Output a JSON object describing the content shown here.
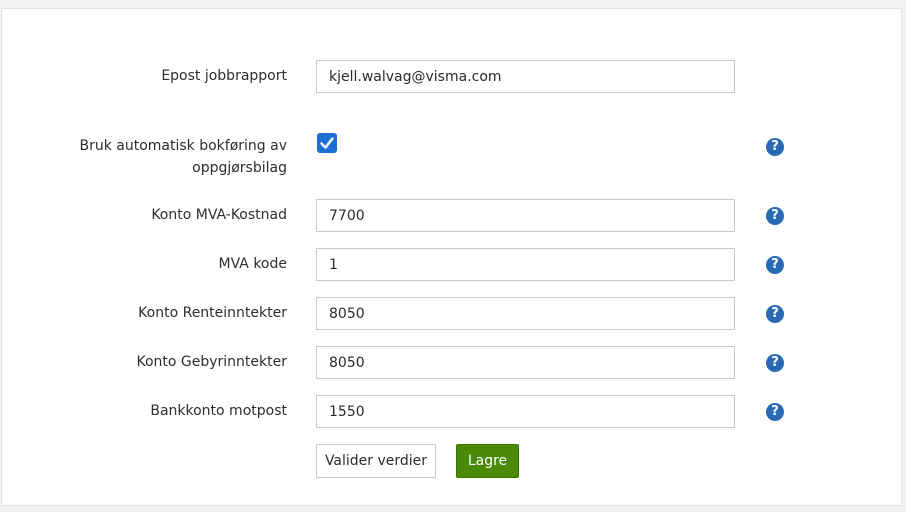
{
  "form": {
    "email_label": "Epost jobbrapport",
    "email_value": "kjell.walvag@visma.com",
    "auto_booking_label_line1": "Bruk automatisk bokføring av",
    "auto_booking_label_line2": "oppgjørsbilag",
    "auto_booking_checked": true,
    "mva_cost_label": "Konto MVA-Kostnad",
    "mva_cost_value": "7700",
    "mva_code_label": "MVA kode",
    "mva_code_value": "1",
    "interest_income_label": "Konto Renteinntekter",
    "interest_income_value": "8050",
    "fee_income_label": "Konto Gebyrinntekter",
    "fee_income_value": "8050",
    "bank_account_label": "Bankkonto motpost",
    "bank_account_value": "1550",
    "help_glyph": "?"
  },
  "actions": {
    "validate_label": "Valider verdier",
    "save_label": "Lagre"
  },
  "colors": {
    "accent_blue": "#1c6fd3",
    "help_blue": "#2a6ab4",
    "save_green": "#4a8a08"
  }
}
